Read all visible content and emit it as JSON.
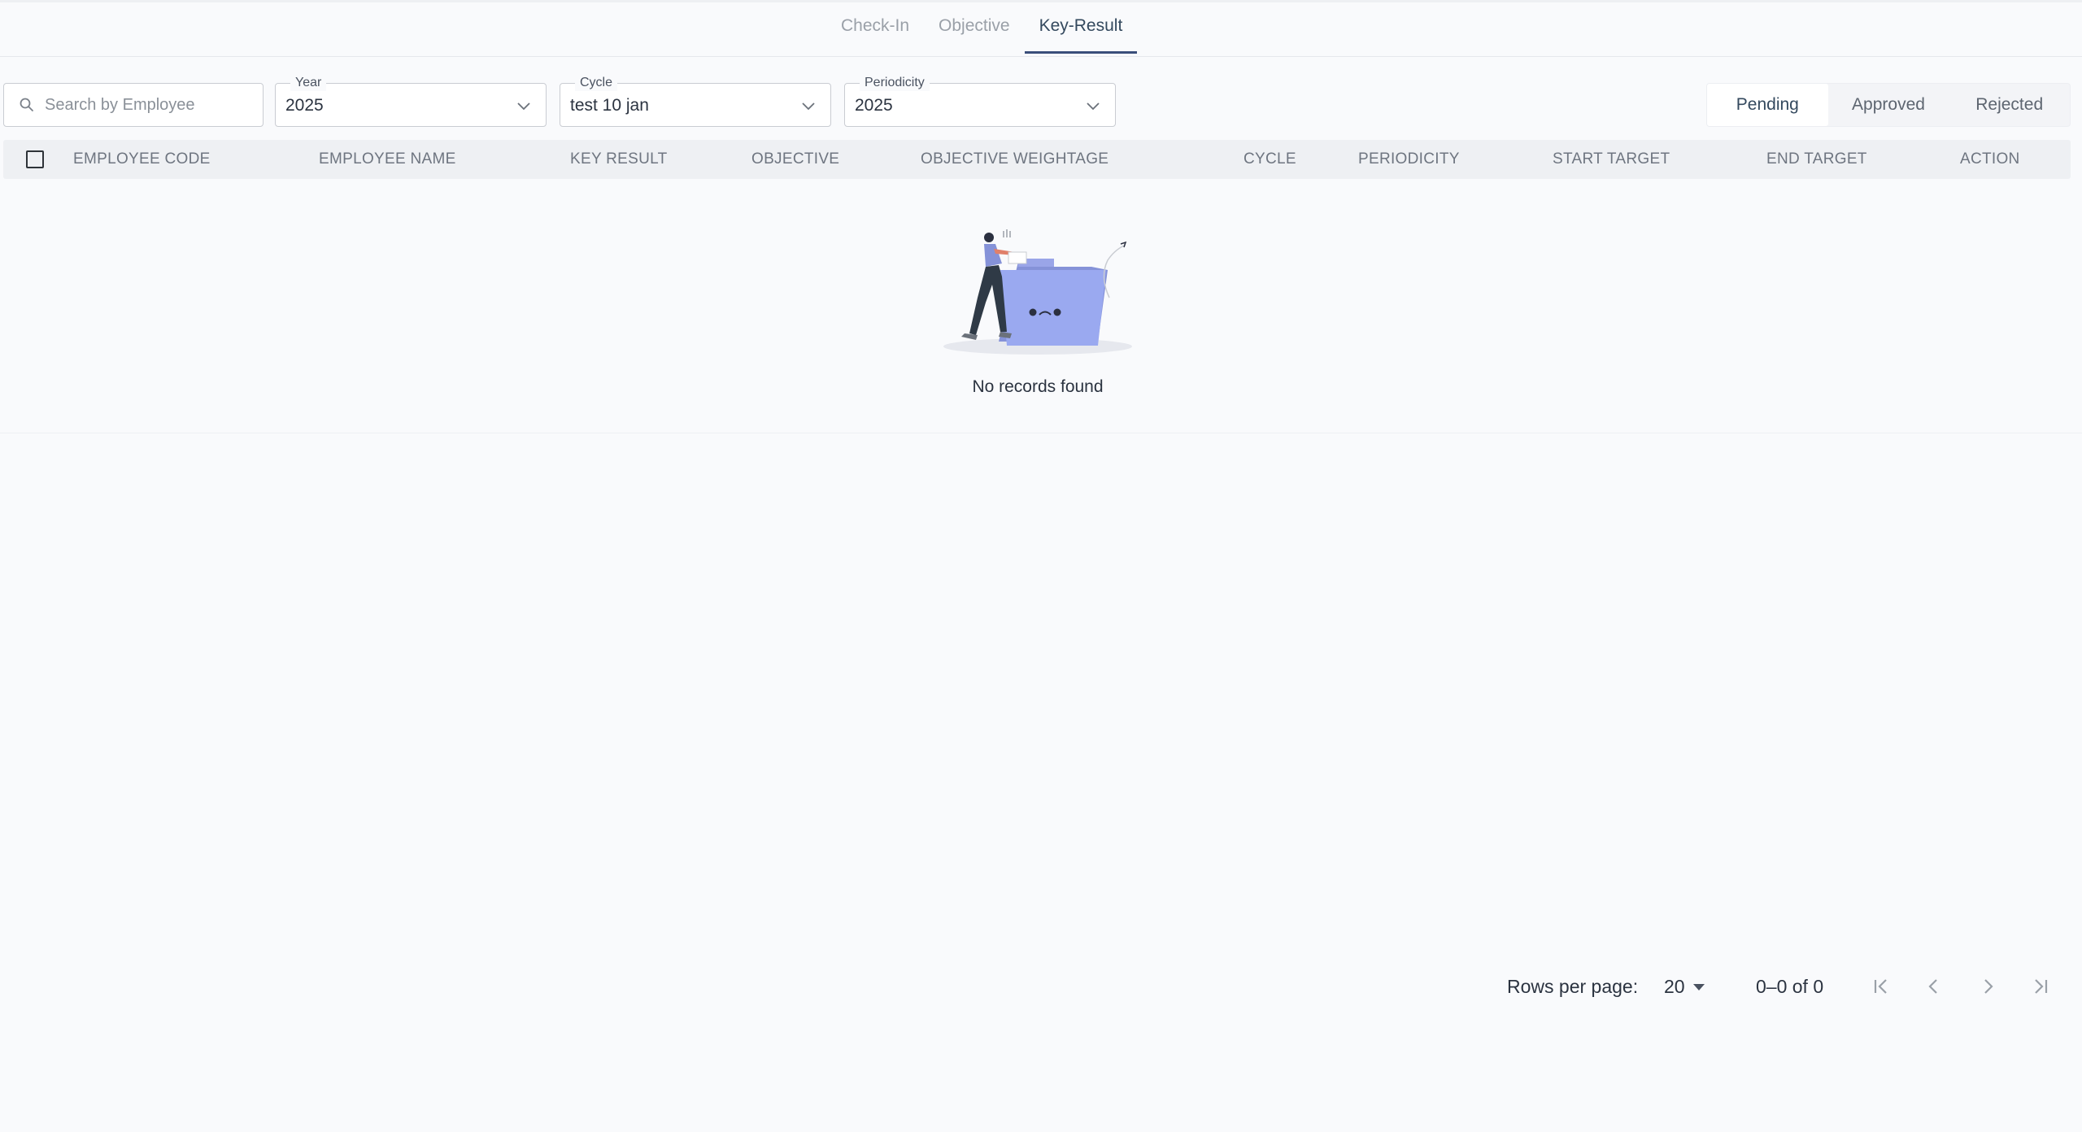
{
  "tabs": [
    {
      "label": "Check-In"
    },
    {
      "label": "Objective"
    },
    {
      "label": "Key-Result"
    }
  ],
  "active_tab": "Key-Result",
  "search": {
    "placeholder": "Search by Employee",
    "value": ""
  },
  "filters": {
    "year": {
      "legend": "Year",
      "value": "2025"
    },
    "cycle": {
      "legend": "Cycle",
      "value": "test 10 jan"
    },
    "periodicity": {
      "legend": "Periodicity",
      "value": "2025"
    }
  },
  "status_tabs": [
    {
      "label": "Pending"
    },
    {
      "label": "Approved"
    },
    {
      "label": "Rejected"
    }
  ],
  "active_status": "Pending",
  "table": {
    "columns": [
      "EMPLOYEE CODE",
      "EMPLOYEE NAME",
      "KEY RESULT",
      "OBJECTIVE",
      "OBJECTIVE WEIGHTAGE",
      "CYCLE",
      "PERIODICITY",
      "START TARGET",
      "END TARGET",
      "ACTION"
    ],
    "rows": [],
    "empty_message": "No records found"
  },
  "pagination": {
    "rows_per_page_label": "Rows per page:",
    "rows_per_page": "20",
    "range": "0–0 of 0"
  },
  "colors": {
    "accent": "#3a4e7a",
    "illustration_folder": "#9aa9f0"
  }
}
